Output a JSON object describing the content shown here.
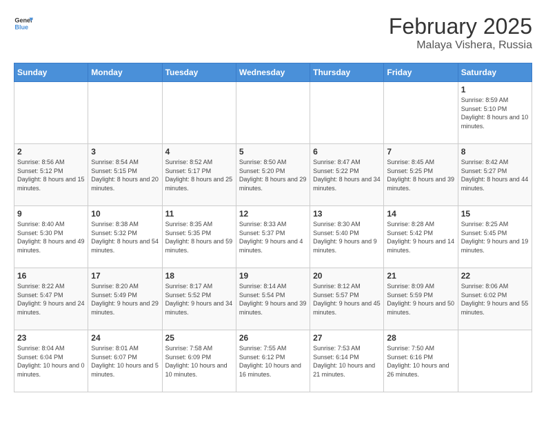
{
  "header": {
    "logo_text_general": "General",
    "logo_text_blue": "Blue",
    "month": "February 2025",
    "location": "Malaya Vishera, Russia"
  },
  "days_of_week": [
    "Sunday",
    "Monday",
    "Tuesday",
    "Wednesday",
    "Thursday",
    "Friday",
    "Saturday"
  ],
  "weeks": [
    [
      {
        "num": "",
        "info": ""
      },
      {
        "num": "",
        "info": ""
      },
      {
        "num": "",
        "info": ""
      },
      {
        "num": "",
        "info": ""
      },
      {
        "num": "",
        "info": ""
      },
      {
        "num": "",
        "info": ""
      },
      {
        "num": "1",
        "info": "Sunrise: 8:59 AM\nSunset: 5:10 PM\nDaylight: 8 hours and 10 minutes."
      }
    ],
    [
      {
        "num": "2",
        "info": "Sunrise: 8:56 AM\nSunset: 5:12 PM\nDaylight: 8 hours and 15 minutes."
      },
      {
        "num": "3",
        "info": "Sunrise: 8:54 AM\nSunset: 5:15 PM\nDaylight: 8 hours and 20 minutes."
      },
      {
        "num": "4",
        "info": "Sunrise: 8:52 AM\nSunset: 5:17 PM\nDaylight: 8 hours and 25 minutes."
      },
      {
        "num": "5",
        "info": "Sunrise: 8:50 AM\nSunset: 5:20 PM\nDaylight: 8 hours and 29 minutes."
      },
      {
        "num": "6",
        "info": "Sunrise: 8:47 AM\nSunset: 5:22 PM\nDaylight: 8 hours and 34 minutes."
      },
      {
        "num": "7",
        "info": "Sunrise: 8:45 AM\nSunset: 5:25 PM\nDaylight: 8 hours and 39 minutes."
      },
      {
        "num": "8",
        "info": "Sunrise: 8:42 AM\nSunset: 5:27 PM\nDaylight: 8 hours and 44 minutes."
      }
    ],
    [
      {
        "num": "9",
        "info": "Sunrise: 8:40 AM\nSunset: 5:30 PM\nDaylight: 8 hours and 49 minutes."
      },
      {
        "num": "10",
        "info": "Sunrise: 8:38 AM\nSunset: 5:32 PM\nDaylight: 8 hours and 54 minutes."
      },
      {
        "num": "11",
        "info": "Sunrise: 8:35 AM\nSunset: 5:35 PM\nDaylight: 8 hours and 59 minutes."
      },
      {
        "num": "12",
        "info": "Sunrise: 8:33 AM\nSunset: 5:37 PM\nDaylight: 9 hours and 4 minutes."
      },
      {
        "num": "13",
        "info": "Sunrise: 8:30 AM\nSunset: 5:40 PM\nDaylight: 9 hours and 9 minutes."
      },
      {
        "num": "14",
        "info": "Sunrise: 8:28 AM\nSunset: 5:42 PM\nDaylight: 9 hours and 14 minutes."
      },
      {
        "num": "15",
        "info": "Sunrise: 8:25 AM\nSunset: 5:45 PM\nDaylight: 9 hours and 19 minutes."
      }
    ],
    [
      {
        "num": "16",
        "info": "Sunrise: 8:22 AM\nSunset: 5:47 PM\nDaylight: 9 hours and 24 minutes."
      },
      {
        "num": "17",
        "info": "Sunrise: 8:20 AM\nSunset: 5:49 PM\nDaylight: 9 hours and 29 minutes."
      },
      {
        "num": "18",
        "info": "Sunrise: 8:17 AM\nSunset: 5:52 PM\nDaylight: 9 hours and 34 minutes."
      },
      {
        "num": "19",
        "info": "Sunrise: 8:14 AM\nSunset: 5:54 PM\nDaylight: 9 hours and 39 minutes."
      },
      {
        "num": "20",
        "info": "Sunrise: 8:12 AM\nSunset: 5:57 PM\nDaylight: 9 hours and 45 minutes."
      },
      {
        "num": "21",
        "info": "Sunrise: 8:09 AM\nSunset: 5:59 PM\nDaylight: 9 hours and 50 minutes."
      },
      {
        "num": "22",
        "info": "Sunrise: 8:06 AM\nSunset: 6:02 PM\nDaylight: 9 hours and 55 minutes."
      }
    ],
    [
      {
        "num": "23",
        "info": "Sunrise: 8:04 AM\nSunset: 6:04 PM\nDaylight: 10 hours and 0 minutes."
      },
      {
        "num": "24",
        "info": "Sunrise: 8:01 AM\nSunset: 6:07 PM\nDaylight: 10 hours and 5 minutes."
      },
      {
        "num": "25",
        "info": "Sunrise: 7:58 AM\nSunset: 6:09 PM\nDaylight: 10 hours and 10 minutes."
      },
      {
        "num": "26",
        "info": "Sunrise: 7:55 AM\nSunset: 6:12 PM\nDaylight: 10 hours and 16 minutes."
      },
      {
        "num": "27",
        "info": "Sunrise: 7:53 AM\nSunset: 6:14 PM\nDaylight: 10 hours and 21 minutes."
      },
      {
        "num": "28",
        "info": "Sunrise: 7:50 AM\nSunset: 6:16 PM\nDaylight: 10 hours and 26 minutes."
      },
      {
        "num": "",
        "info": ""
      }
    ]
  ]
}
